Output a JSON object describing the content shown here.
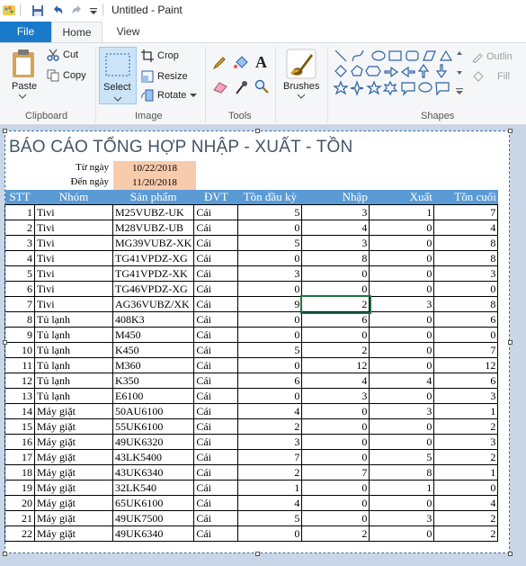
{
  "window": {
    "title": "Untitled - Paint"
  },
  "tabs": [
    {
      "label": "File"
    },
    {
      "label": "Home"
    },
    {
      "label": "View"
    }
  ],
  "ribbon": {
    "clipboard": {
      "paste": "Paste",
      "cut": "Cut",
      "copy": "Copy",
      "group": "Clipboard"
    },
    "image": {
      "select": "Select",
      "crop": "Crop",
      "resize": "Resize",
      "rotate": "Rotate",
      "group": "Image"
    },
    "tools": {
      "group": "Tools"
    },
    "brushes": {
      "label": "Brushes"
    },
    "shapes": {
      "outline": "Outlin",
      "fill": "Fill",
      "group": "Shapes"
    }
  },
  "report": {
    "title": "BÁO CÁO TỔNG HỢP NHẬP - XUẤT - TỒN",
    "from_label": "Từ ngày",
    "from_value": "10/22/2018",
    "to_label": "Đến ngày",
    "to_value": "11/20/2018",
    "headers": [
      "STT",
      "Nhóm",
      "Sản phẩm",
      "ĐVT",
      "Tồn đầu kỳ",
      "Nhập",
      "Xuất",
      "Tồn cuối"
    ],
    "rows": [
      [
        "1",
        "Tivi",
        "M25VUBZ-UK",
        "Cái",
        "5",
        "3",
        "1",
        "7"
      ],
      [
        "2",
        "Tivi",
        "M28VUBZ-UB",
        "Cái",
        "0",
        "4",
        "0",
        "4"
      ],
      [
        "3",
        "Tivi",
        "MG39VUBZ-XK",
        "Cái",
        "5",
        "3",
        "0",
        "8"
      ],
      [
        "4",
        "Tivi",
        "TG41VPDZ-XG",
        "Cái",
        "0",
        "8",
        "0",
        "8"
      ],
      [
        "5",
        "Tivi",
        "TG41VPDZ-XK",
        "Cái",
        "3",
        "0",
        "0",
        "3"
      ],
      [
        "6",
        "Tivi",
        "TG46VPDZ-XG",
        "Cái",
        "0",
        "0",
        "0",
        "0"
      ],
      [
        "7",
        "Tivi",
        "AG36VUBZ/XK",
        "Cái",
        "9",
        "2",
        "3",
        "8"
      ],
      [
        "8",
        "Tủ lạnh",
        "408K3",
        "Cái",
        "0",
        "6",
        "0",
        "6"
      ],
      [
        "9",
        "Tủ lạnh",
        "M450",
        "Cái",
        "0",
        "0",
        "0",
        "0"
      ],
      [
        "10",
        "Tủ lạnh",
        "K450",
        "Cái",
        "5",
        "2",
        "0",
        "7"
      ],
      [
        "11",
        "Tủ lạnh",
        "M360",
        "Cái",
        "0",
        "12",
        "0",
        "12"
      ],
      [
        "12",
        "Tủ lạnh",
        "K350",
        "Cái",
        "6",
        "4",
        "4",
        "6"
      ],
      [
        "13",
        "Tủ lạnh",
        "E6100",
        "Cái",
        "0",
        "3",
        "0",
        "3"
      ],
      [
        "14",
        "Máy giặt",
        "50AU6100",
        "Cái",
        "4",
        "0",
        "3",
        "1"
      ],
      [
        "15",
        "Máy giặt",
        "55UK6100",
        "Cái",
        "2",
        "0",
        "0",
        "2"
      ],
      [
        "16",
        "Máy giặt",
        "49UK6320",
        "Cái",
        "3",
        "0",
        "0",
        "3"
      ],
      [
        "17",
        "Máy giặt",
        "43LK5400",
        "Cái",
        "7",
        "0",
        "5",
        "2"
      ],
      [
        "18",
        "Máy giặt",
        "43UK6340",
        "Cái",
        "2",
        "7",
        "8",
        "1"
      ],
      [
        "19",
        "Máy giặt",
        "32LK540",
        "Cái",
        "1",
        "0",
        "1",
        "0"
      ],
      [
        "20",
        "Máy giặt",
        "65UK6100",
        "Cái",
        "4",
        "0",
        "0",
        "4"
      ],
      [
        "21",
        "Máy giặt",
        "49UK7500",
        "Cái",
        "5",
        "0",
        "3",
        "2"
      ],
      [
        "22",
        "Máy giặt",
        "49UK6340",
        "Cái",
        "0",
        "2",
        "0",
        "2"
      ]
    ]
  },
  "colors": {
    "file_tab": "#1979ca",
    "header_fill": "#5b9bd5",
    "date_fill": "#f8cbad",
    "title_text": "#44546a",
    "select_highlight": "#cce4f7",
    "workarea": "#c9d6e7"
  }
}
